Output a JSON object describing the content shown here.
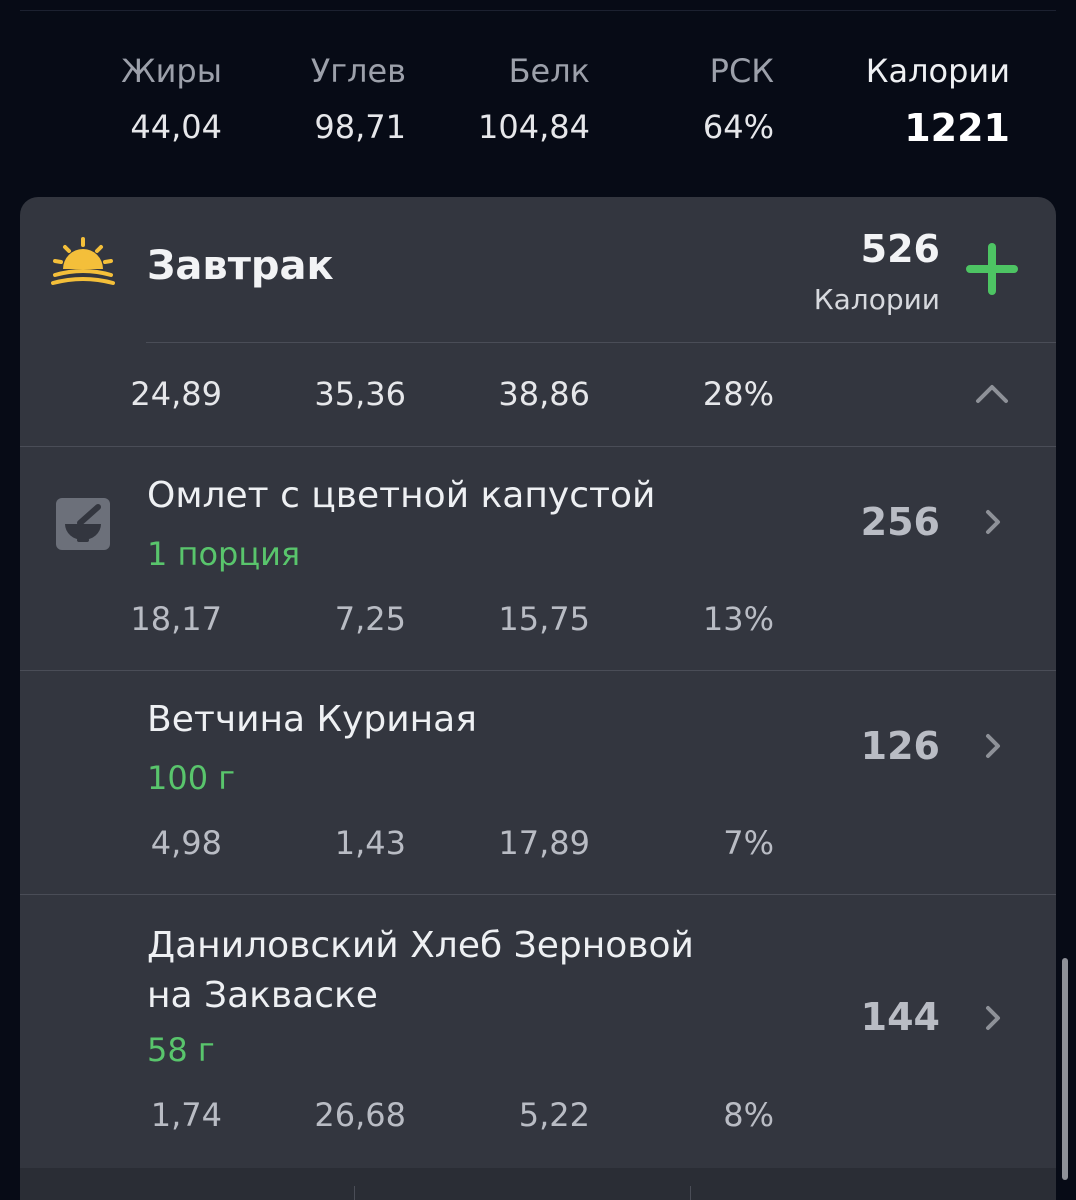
{
  "summary": {
    "fat_label": "Жиры",
    "fat_value": "44,04",
    "carbs_label": "Углев",
    "carbs_value": "98,71",
    "protein_label": "Белк",
    "protein_value": "104,84",
    "rsk_label": "РСК",
    "rsk_value": "64%",
    "calories_label": "Калории",
    "calories_value": "1221"
  },
  "meal": {
    "title": "Завтрак",
    "icon": "sunrise-icon",
    "calories": "526",
    "calories_label": "Калории",
    "add_icon": "plus-icon",
    "collapse_icon": "chevron-up-icon",
    "macros": {
      "fat": "24,89",
      "carbs": "35,36",
      "protein": "38,86",
      "rsk": "28%"
    }
  },
  "items": [
    {
      "name_lines": [
        "Омлет с цветной капустой"
      ],
      "portion": "1 порция",
      "calories": "256",
      "icon": "recipe-bowl-icon",
      "macros": {
        "fat": "18,17",
        "carbs": "7,25",
        "protein": "15,75",
        "rsk": "13%"
      }
    },
    {
      "name_lines": [
        "Ветчина Куриная"
      ],
      "portion": "100 г",
      "calories": "126",
      "macros": {
        "fat": "4,98",
        "carbs": "1,43",
        "protein": "17,89",
        "rsk": "7%"
      }
    },
    {
      "name_lines": [
        "Даниловский Хлеб Зерновой",
        "на Закваске"
      ],
      "portion": "58 г",
      "calories": "144",
      "macros": {
        "fat": "1,74",
        "carbs": "26,68",
        "protein": "5,22",
        "rsk": "8%"
      }
    }
  ],
  "colors": {
    "background": "#070b16",
    "card": "#33363f",
    "accent_green": "#4dc463",
    "sun_yellow": "#f4bf3a"
  }
}
